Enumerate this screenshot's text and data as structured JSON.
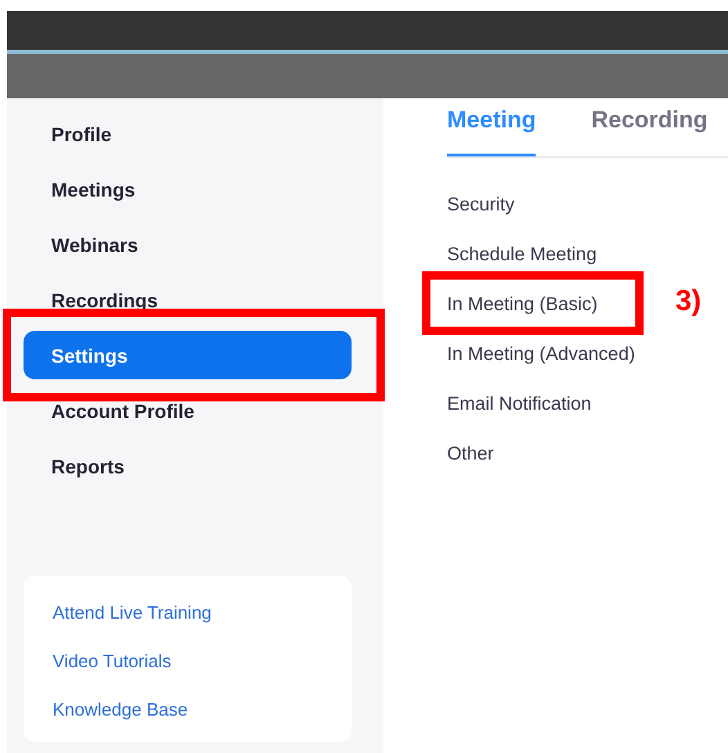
{
  "sidebar": {
    "items": [
      {
        "label": "Profile",
        "selected": false,
        "highlighted": false
      },
      {
        "label": "Meetings",
        "selected": false,
        "highlighted": false
      },
      {
        "label": "Webinars",
        "selected": false,
        "highlighted": false
      },
      {
        "label": "Recordings",
        "selected": false,
        "highlighted": false
      },
      {
        "label": "Settings",
        "selected": true,
        "highlighted": true
      },
      {
        "label": "Account Profile",
        "selected": false,
        "highlighted": false
      },
      {
        "label": "Reports",
        "selected": false,
        "highlighted": false
      }
    ],
    "help_links": [
      "Attend Live Training",
      "Video Tutorials",
      "Knowledge Base"
    ]
  },
  "tabs": [
    {
      "label": "Meeting",
      "selected": true
    },
    {
      "label": "Recording",
      "selected": false
    }
  ],
  "sections": [
    {
      "label": "Security",
      "highlighted": false
    },
    {
      "label": "Schedule Meeting",
      "highlighted": false
    },
    {
      "label": "In Meeting (Basic)",
      "highlighted": true,
      "step": "3)"
    },
    {
      "label": "In Meeting (Advanced)",
      "highlighted": false
    },
    {
      "label": "Email Notification",
      "highlighted": false
    },
    {
      "label": "Other",
      "highlighted": false
    }
  ]
}
